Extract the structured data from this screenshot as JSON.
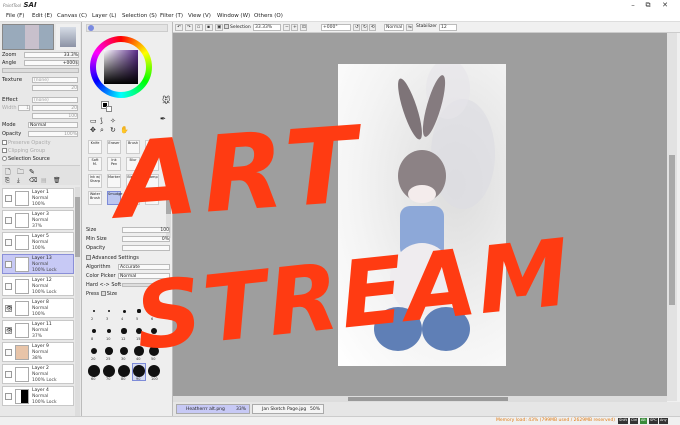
{
  "window": {
    "app_name": "SAI",
    "logo_prefix": "PaintTool",
    "minimize": "–",
    "restore": "⧉",
    "close": "✕"
  },
  "menu": [
    {
      "label": "File (F)"
    },
    {
      "label": "Edit (E)"
    },
    {
      "label": "Canvas (C)"
    },
    {
      "label": "Layer (L)"
    },
    {
      "label": "Selection (S)"
    },
    {
      "label": "Filter (T)"
    },
    {
      "label": "View (V)"
    },
    {
      "label": "Window (W)"
    },
    {
      "label": "Others (O)"
    }
  ],
  "navigator": {
    "zoom_label": "Zoom",
    "zoom_value": "33.3%",
    "angle_label": "Angle",
    "angle_value": "+000$"
  },
  "layer_props": {
    "texture_label": "Texture",
    "texture_value": "(none)",
    "texture_amount": "20",
    "effect_label": "Effect",
    "effect_value": "(none)",
    "effect_amount": "20",
    "width_label": "Width",
    "width_value": "1",
    "intensity": "100",
    "mode_label": "Mode",
    "mode_value": "Normal",
    "opacity_label": "Opacity",
    "opacity_value": "100%",
    "preserve_opacity": "Preserve Opacity",
    "clipping_group": "Clipping Group",
    "selection_source": "Selection Source"
  },
  "layers": [
    {
      "name": "Layer 1",
      "mode": "Normal",
      "opacity": "100%",
      "locked": false,
      "selected": false,
      "visible": false
    },
    {
      "name": "Layer 3",
      "mode": "Normal",
      "opacity": "37%",
      "locked": false,
      "selected": false,
      "visible": false
    },
    {
      "name": "Layer 5",
      "mode": "Normal",
      "opacity": "100%",
      "locked": false,
      "selected": false,
      "visible": false
    },
    {
      "name": "Layer 13",
      "mode": "Normal",
      "opacity": "100%",
      "locked": true,
      "selected": true,
      "visible": false
    },
    {
      "name": "Layer 12",
      "mode": "Normal",
      "opacity": "100%",
      "locked": true,
      "selected": false,
      "visible": false
    },
    {
      "name": "Layer 8",
      "mode": "Normal",
      "opacity": "100%",
      "locked": false,
      "selected": false,
      "visible": true
    },
    {
      "name": "Layer 11",
      "mode": "Normal",
      "opacity": "37%",
      "locked": false,
      "selected": false,
      "visible": true
    },
    {
      "name": "Layer 9",
      "mode": "Normal",
      "opacity": "38%",
      "locked": false,
      "selected": false,
      "visible": false
    },
    {
      "name": "Layer 2",
      "mode": "Normal",
      "opacity": "100%",
      "locked": true,
      "selected": false,
      "visible": false
    },
    {
      "name": "Layer 4",
      "mode": "Normal",
      "opacity": "100%",
      "locked": true,
      "selected": false,
      "visible": false
    }
  ],
  "lock_label": "Lock",
  "tools": [
    {
      "label": "Knife"
    },
    {
      "label": "Eraser"
    },
    {
      "label": "Brush"
    },
    {
      "label": "Pen"
    },
    {
      "label": "Soft M."
    },
    {
      "label": "Ink Pen"
    },
    {
      "label": "Blur"
    },
    {
      "label": "Water"
    },
    {
      "label": "Ink w/ Sharp"
    },
    {
      "label": "Marker"
    },
    {
      "label": "Binary"
    },
    {
      "label": "Stamp"
    },
    {
      "label": "Water Brush"
    },
    {
      "label": "Smudge"
    },
    {
      "label": "Pencil"
    },
    {
      "label": "Sharp"
    }
  ],
  "brush": {
    "size_label": "Size",
    "size_value": "100",
    "min_size_label": "Min Size",
    "min_size_value": "0%",
    "opacity_label": "Opacity",
    "opacity_value": "",
    "advanced_label": "Advanced Settings",
    "algorithm_label": "Algorithm",
    "algorithm_value": "Accurate",
    "color_picker_label": "Color Picker",
    "color_picker_value": "Normal",
    "hard_soft_label": "Hard <-> Soft",
    "press_label": "Press",
    "press_size": "Size",
    "size_presets": [
      "2",
      "3",
      "4",
      "5",
      "6",
      "8",
      "10",
      "12",
      "15",
      "18",
      "20",
      "25",
      "30",
      "40",
      "50",
      "60",
      "70",
      "80",
      "90",
      "100"
    ]
  },
  "canvas_toolbar": {
    "selection_label": "Selection",
    "zoom_value": "33.33%",
    "angle_value": "+000°",
    "mode_value": "Normal",
    "stabilizer_label": "Stabilizer",
    "stabilizer_value": "12"
  },
  "tabs": [
    {
      "name": "Heatherrr alt.png",
      "zoom": "33%",
      "active": true
    },
    {
      "name": "Jan Sketch Page.jpg",
      "zoom": "50%",
      "active": false
    }
  ],
  "status": {
    "memory": "Memory load: 43% (799MB used / 2629MB reserved)",
    "keys": [
      "Shift",
      "Ctrl",
      "Alt",
      "SPC",
      "Any"
    ]
  },
  "overlay": {
    "line1": "ART",
    "line2": "STREAM",
    "color": "#ff3b12"
  },
  "colors": {
    "accent": "#8a8fd8",
    "memory_text": "#e07b13",
    "canvas_bg": "#9e9e9e"
  }
}
